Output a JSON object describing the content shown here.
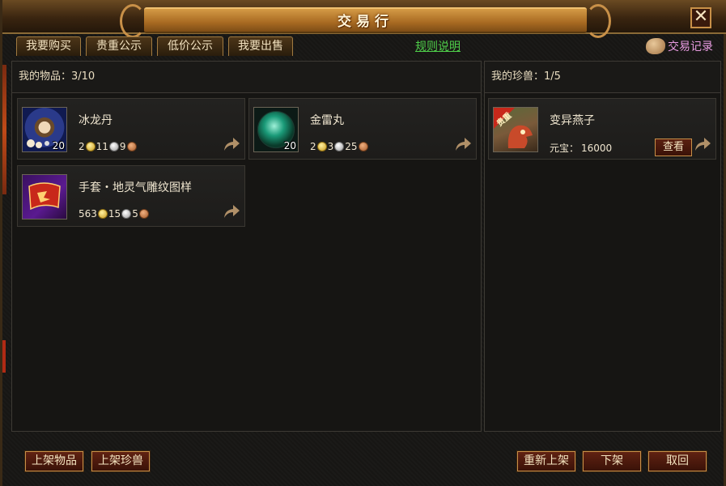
{
  "window": {
    "title": "交易行",
    "close_label": "✕"
  },
  "tabs": [
    {
      "label": "我要购买"
    },
    {
      "label": "贵重公示"
    },
    {
      "label": "低价公示"
    },
    {
      "label": "我要出售"
    }
  ],
  "rules_link": "规则说明",
  "trade_record": "交易记录",
  "items_panel": {
    "header": "我的物品：3/10",
    "items": [
      {
        "name": "冰龙丹",
        "count": "20",
        "gold": "2",
        "silver": "11",
        "copper": "9",
        "icon": "ice-dragon-pill-icon"
      },
      {
        "name": "金雷丸",
        "count": "20",
        "gold": "2",
        "silver": "3",
        "copper": "25",
        "icon": "golden-thunder-pill-icon"
      },
      {
        "name": "手套・地灵气雕纹图样",
        "count": "",
        "gold": "563",
        "silver": "15",
        "copper": "5",
        "icon": "glove-pattern-scroll-icon"
      }
    ]
  },
  "pets_panel": {
    "header": "我的珍兽：1/5",
    "pets": [
      {
        "name": "变异燕子",
        "price_label": "元宝：",
        "price": "16000",
        "view_label": "查看",
        "badge": "贵重",
        "icon": "mutant-swallow-icon"
      }
    ]
  },
  "buttons": {
    "list_item": "上架物品",
    "list_pet": "上架珍兽",
    "relist": "重新上架",
    "delist": "下架",
    "cancel": "取回"
  },
  "colors": {
    "rules_link": "#4fcf4a",
    "trade_record": "#e79be0",
    "title_scroll": "#a86a22"
  }
}
